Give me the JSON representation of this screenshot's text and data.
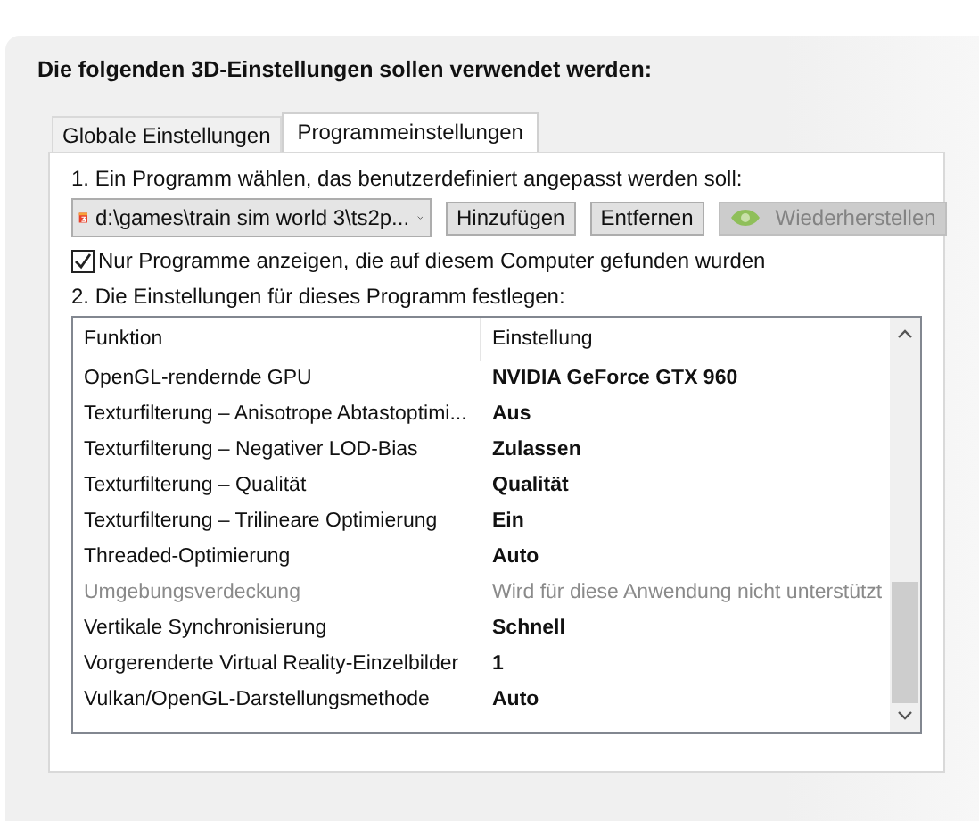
{
  "heading": "Die folgenden 3D-Einstellungen sollen verwendet werden:",
  "tabs": [
    {
      "label": "Globale Einstellungen",
      "selected": false
    },
    {
      "label": "Programmeinstellungen",
      "selected": true
    }
  ],
  "step1": "1. Ein Programm wählen, das benutzerdefiniert angepasst werden soll:",
  "program": {
    "value": "d:\\games\\train sim world 3\\ts2p..."
  },
  "buttons": [
    {
      "label": "Hinzufügen",
      "disabled": false,
      "kind": "plain"
    },
    {
      "label": "Entfernen",
      "disabled": false,
      "kind": "plain"
    },
    {
      "label": "Wiederherstellen",
      "disabled": true,
      "kind": "logo"
    }
  ],
  "filter": {
    "label": "Nur Programme anzeigen, die auf diesem Computer gefunden wurden",
    "checked": true
  },
  "step2": "2. Die Einstellungen für dieses Programm festlegen:",
  "table": {
    "columns": [
      "Funktion",
      "Einstellung"
    ],
    "rows": [
      {
        "function": "OpenGL-rendernde GPU",
        "setting": "NVIDIA GeForce GTX 960",
        "disabled": false
      },
      {
        "function": "Texturfilterung – Anisotrope Abtastoptimi...",
        "setting": "Aus",
        "disabled": false
      },
      {
        "function": "Texturfilterung – Negativer LOD-Bias",
        "setting": "Zulassen",
        "disabled": false
      },
      {
        "function": "Texturfilterung – Qualität",
        "setting": "Qualität",
        "disabled": false
      },
      {
        "function": "Texturfilterung – Trilineare Optimierung",
        "setting": "Ein",
        "disabled": false
      },
      {
        "function": "Threaded-Optimierung",
        "setting": "Auto",
        "disabled": false
      },
      {
        "function": "Umgebungsverdeckung",
        "setting": "Wird für diese Anwendung nicht unterstützt",
        "disabled": true
      },
      {
        "function": "Vertikale Synchronisierung",
        "setting": "Schnell",
        "disabled": false
      },
      {
        "function": "Vorgerenderte Virtual Reality-Einzelbilder",
        "setting": "1",
        "disabled": false
      },
      {
        "function": "Vulkan/OpenGL-Darstellungsmethode",
        "setting": "Auto",
        "disabled": false
      }
    ]
  }
}
